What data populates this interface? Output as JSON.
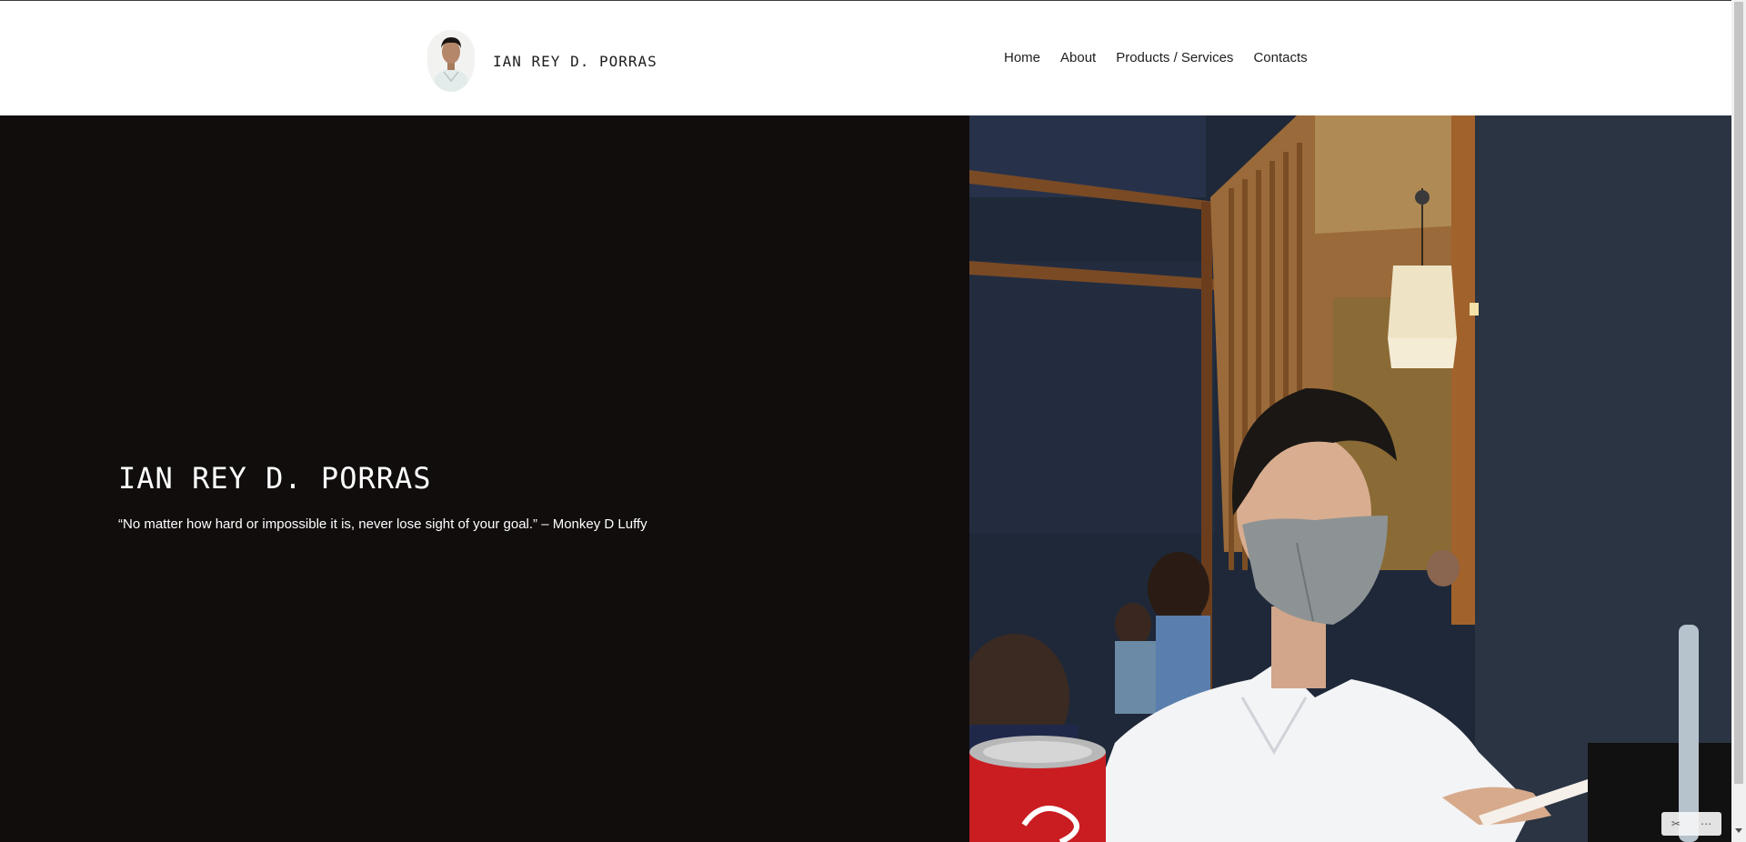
{
  "header": {
    "site_title": "IAN REY D. PORRAS",
    "nav": [
      {
        "label": "Home"
      },
      {
        "label": "About"
      },
      {
        "label": "Products / Services"
      },
      {
        "label": "Contacts"
      }
    ]
  },
  "hero": {
    "title": "IAN REY D. PORRAS",
    "quote": "“No matter how hard or impossible it is, never lose sight of your goal.” – Monkey D Luffy"
  },
  "admin_widget": {
    "tools_icon": "✂",
    "more_icon": "⋯"
  }
}
